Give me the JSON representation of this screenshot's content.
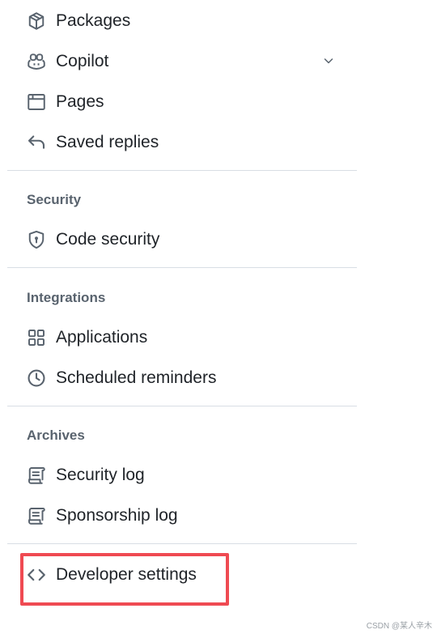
{
  "nav": {
    "packages": {
      "label": "Packages",
      "icon": "package-icon"
    },
    "copilot": {
      "label": "Copilot",
      "icon": "copilot-icon",
      "expandable": true
    },
    "pages": {
      "label": "Pages",
      "icon": "browser-icon"
    },
    "saved_replies": {
      "label": "Saved replies",
      "icon": "reply-icon"
    }
  },
  "security": {
    "heading": "Security",
    "code_security": {
      "label": "Code security",
      "icon": "shield-lock-icon"
    }
  },
  "integrations": {
    "heading": "Integrations",
    "applications": {
      "label": "Applications",
      "icon": "apps-icon"
    },
    "scheduled_reminders": {
      "label": "Scheduled reminders",
      "icon": "clock-icon"
    }
  },
  "archives": {
    "heading": "Archives",
    "security_log": {
      "label": "Security log",
      "icon": "log-icon"
    },
    "sponsorship_log": {
      "label": "Sponsorship log",
      "icon": "log-icon"
    }
  },
  "developer_settings": {
    "label": "Developer settings",
    "icon": "code-icon"
  },
  "colors": {
    "highlight": "#ef4a52",
    "text": "#1f2328",
    "muted": "#59636e",
    "divider": "#d8dee4"
  },
  "watermark": "CSDN @某人辛木"
}
